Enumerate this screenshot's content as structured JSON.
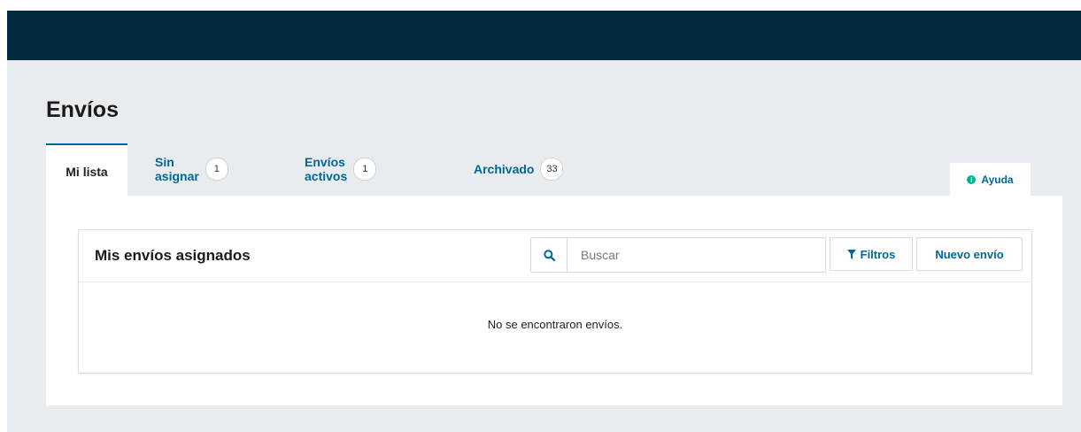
{
  "page": {
    "title": "Envíos"
  },
  "tabs": [
    {
      "label": "Mi lista",
      "count": null
    },
    {
      "label": "Sin asignar",
      "count": "1"
    },
    {
      "label": "Envíos activos",
      "count": "1"
    },
    {
      "label": "Archivado",
      "count": "33"
    }
  ],
  "help": {
    "label": "Ayuda"
  },
  "list": {
    "title": "Mis envíos asignados",
    "search_placeholder": "Buscar",
    "search_value": "",
    "filters_label": "Filtros",
    "new_label": "Nuevo envío",
    "empty_message": "No se encontraron envíos."
  },
  "colors": {
    "topbar": "#002b3e",
    "link": "#006798",
    "help_icon": "#00b28d",
    "background": "#e8ecee"
  }
}
